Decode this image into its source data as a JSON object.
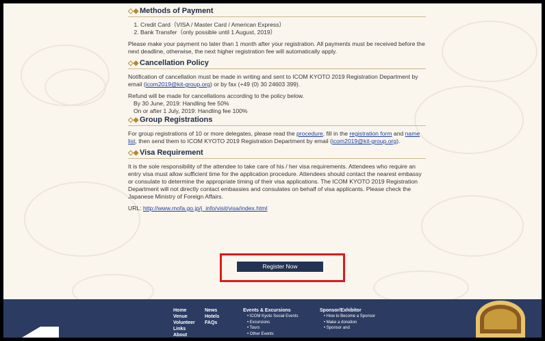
{
  "sections": {
    "payment": {
      "title": "Methods of Payment",
      "methods": [
        "Credit Card（VISA / Master Card / American Express）",
        "Bank Transfer（only possible until 1 August, 2019）"
      ],
      "note": "Please make your payment no later than 1 month after your registration. All payments must be received before the next deadline, otherwise, the next higher registration fee will automatically apply."
    },
    "cancellation": {
      "title": "Cancellation Policy",
      "note_prefix": "Notification of cancellation must be made in writing and sent to ICOM KYOTO 2019 Registration Department by email (",
      "email": "icom2019@kit-group.org",
      "note_suffix": ") or by fax (+49 (0) 30 24603 399).",
      "refund_title": "Refund will be made for cancellations according to the policy below.",
      "refund_items": [
        "By 30 June, 2019: Handling fee 50%",
        "On or after 1 July, 2019: Handling fee 100%"
      ]
    },
    "group": {
      "title": "Group Registrations",
      "text1": "For group registrations of 10 or more delegates, please read the ",
      "link_procedure": "procedure",
      "text2": ", fill in the ",
      "link_form": "registration form",
      "text3": " and ",
      "link_namelist": "name list",
      "text4": ", then send them to ICOM KYOTO 2019 Registration Department by email (",
      "email": "icom2019@kit-group.org",
      "text5": ")."
    },
    "visa": {
      "title": "Visa Requirement",
      "text": "It is the sole responsibility of the attendee to take care of his / her visa requirements. Attendees who require an entry visa must allow sufficient time for the application procedure. Attendees should contact the nearest embassy or consulate to determine the appropriate timing of their visa applications. The ICOM KYOTO 2019 Registration Department will not directly contact embassies and consulates on behalf of visa applicants. Please check the Japanese Ministry of Foreign Affairs.",
      "url_label": "URL: ",
      "url": "http://www.mofa.go.jp/j_info/visit/visa/index.html"
    }
  },
  "cta": {
    "label": "Register Now"
  },
  "footer": {
    "col1": [
      "Home",
      "Venue",
      "Volunteer",
      "Links",
      "About"
    ],
    "col2": [
      "News",
      "Hotels",
      "FAQs"
    ],
    "events_title": "Events & Excursions",
    "events": [
      "ICOM Kyoto Social Events",
      "Excursions",
      "Tours",
      "Other Events"
    ],
    "sponsor_title": "Sponsor/Exhibitor",
    "sponsor": [
      "How to Become a Sponsor",
      "Make a donation",
      "Sponsor and"
    ]
  },
  "colors": {
    "accent": "#b38a2e",
    "footer_bg": "#2b3b62",
    "button_bg": "#243353",
    "highlight": "#e01818"
  },
  "icons": {
    "section": "diamond-bullet-icon"
  }
}
